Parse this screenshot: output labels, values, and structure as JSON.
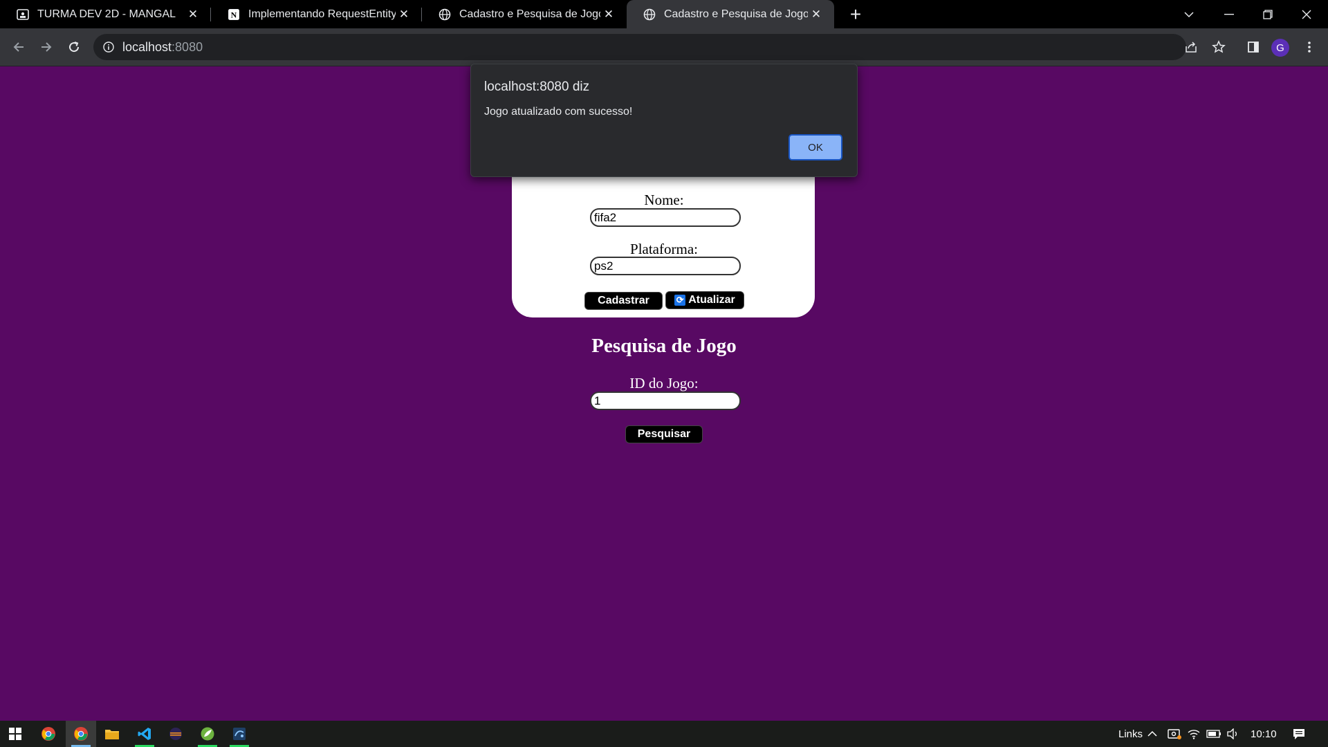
{
  "browser": {
    "tabs": [
      {
        "title": "TURMA DEV 2D - MANGAL",
        "icon": "classroom-icon",
        "active": false
      },
      {
        "title": "Implementando RequestEntity ,",
        "icon": "notion-icon",
        "active": false
      },
      {
        "title": "Cadastro e Pesquisa de Jogos",
        "icon": "globe-icon",
        "active": false
      },
      {
        "title": "Cadastro e Pesquisa de Jogos",
        "icon": "globe-icon",
        "active": true
      }
    ],
    "address": {
      "host": "localhost",
      "port": ":8080"
    },
    "profile_initial": "G"
  },
  "dialog": {
    "title": "localhost:8080 diz",
    "message": "Jogo atualizado com sucesso!",
    "ok_label": "OK"
  },
  "form": {
    "nome_label": "Nome:",
    "nome_value": "fifa2",
    "plataforma_label": "Plataforma:",
    "plataforma_value": "ps2",
    "cadastrar_label": "Cadastrar",
    "atualizar_label": "Atualizar"
  },
  "search": {
    "heading": "Pesquisa de Jogo",
    "id_label": "ID do Jogo:",
    "id_value": "1",
    "button_label": "Pesquisar"
  },
  "taskbar": {
    "links_label": "Links",
    "time": "10:10"
  },
  "colors": {
    "page_background": "#580963",
    "dialog_ok": "#8ab4f8"
  }
}
